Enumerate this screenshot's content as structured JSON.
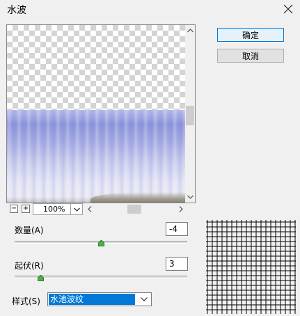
{
  "window": {
    "title": "水波",
    "close_icon": "close-icon"
  },
  "buttons": {
    "ok": "确定",
    "cancel": "取消"
  },
  "preview": {
    "zoom_out": "−",
    "zoom_in": "+",
    "zoom_value": "100%"
  },
  "controls": {
    "amount": {
      "label": "数量(A)",
      "value": "-4",
      "slider_fraction": 0.5
    },
    "ridges": {
      "label": "起伏(R)",
      "value": "3",
      "slider_fraction": 0.15
    },
    "style": {
      "label": "样式(S)",
      "value": "水池波纹"
    }
  },
  "colors": {
    "accent": "#0078d7",
    "slider_thumb": "#3a9a4a"
  }
}
